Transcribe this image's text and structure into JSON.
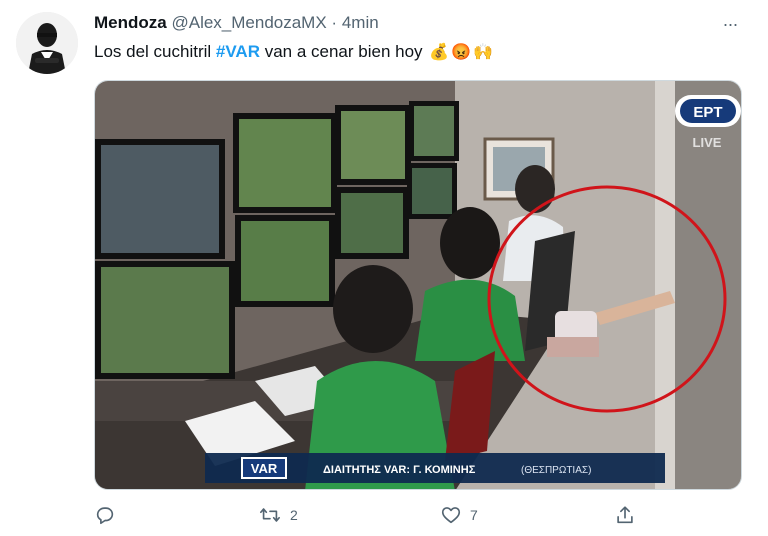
{
  "tweet": {
    "author_name": "Mendoza",
    "handle": "@Alex_MendozaMX",
    "separator": "·",
    "time": "4min",
    "more_label": "···",
    "text_before": "Los del cuchitril ",
    "hashtag": "#VAR",
    "text_after": " van a cenar bien hoy",
    "emojis": [
      "💰",
      "😡",
      "🙌"
    ]
  },
  "media": {
    "broadcaster_logo": "ΕΡΤ",
    "live_label": "LIVE",
    "var_badge": "VAR",
    "caption": "ΔΙΑΙΤΗΤΗΣ VAR:  Γ. ΚΟΜΙΝΗΣ",
    "caption_region": "(ΘΕΣΠΡΩΤΙΑΣ)",
    "highlight_color": "#d0141a"
  },
  "actions": {
    "reply_icon": "reply-icon",
    "retweet_icon": "retweet-icon",
    "retweet_count": "2",
    "like_icon": "heart-icon",
    "like_count": "7",
    "share_icon": "share-icon"
  },
  "colors": {
    "accent": "#1d9bf0",
    "secondary_text": "#536471",
    "primary_text": "#0f1419"
  }
}
